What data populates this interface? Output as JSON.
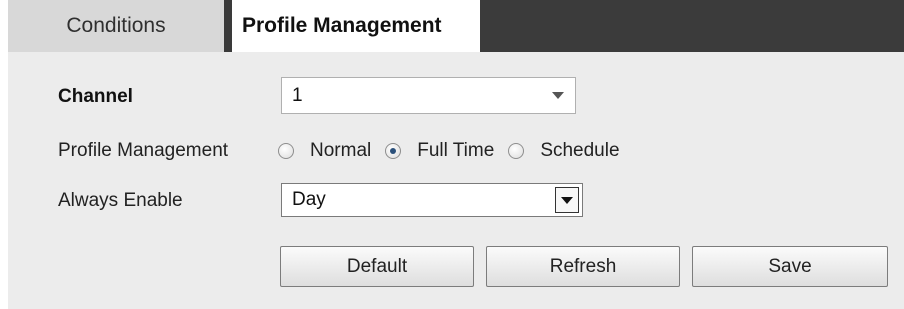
{
  "tabs": {
    "conditions": "Conditions",
    "profile_management": "Profile Management"
  },
  "form": {
    "channel": {
      "label": "Channel",
      "value": "1"
    },
    "profile_management": {
      "label": "Profile Management",
      "options": [
        {
          "label": "Normal",
          "selected": false
        },
        {
          "label": "Full Time",
          "selected": true
        },
        {
          "label": "Schedule",
          "selected": false
        }
      ]
    },
    "always_enable": {
      "label": "Always Enable",
      "value": "Day"
    }
  },
  "buttons": {
    "default": "Default",
    "refresh": "Refresh",
    "save": "Save"
  }
}
